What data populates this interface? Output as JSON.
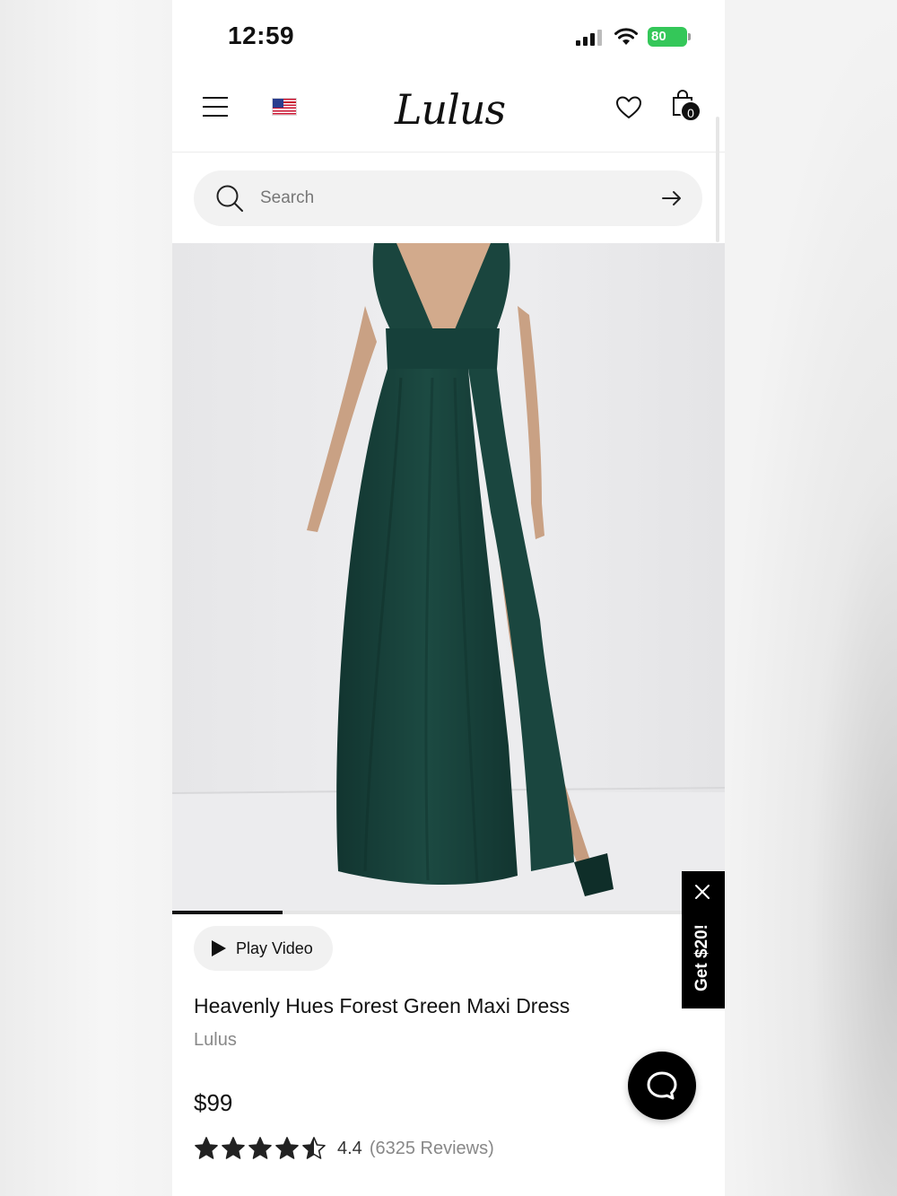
{
  "status_bar": {
    "time": "12:59",
    "battery": "80"
  },
  "header": {
    "logo": "Lulus",
    "bag_count": "0",
    "icons": [
      "menu-icon",
      "us-flag-icon",
      "heart-icon",
      "shopping-bag-icon"
    ]
  },
  "search": {
    "placeholder": "Search",
    "value": ""
  },
  "carousel": {
    "progress": 0.2
  },
  "product": {
    "play_video_label": "Play Video",
    "title": "Heavenly Hues Forest Green Maxi Dress",
    "brand": "Lulus",
    "price": "$99",
    "rating": 4.4,
    "rating_label": "4.4",
    "reviews_label": "(6325 Reviews)"
  },
  "promo": {
    "label": "Get $20!"
  },
  "colors": {
    "dress": "#173f38",
    "battery": "#34c759",
    "accent": "#000000"
  }
}
